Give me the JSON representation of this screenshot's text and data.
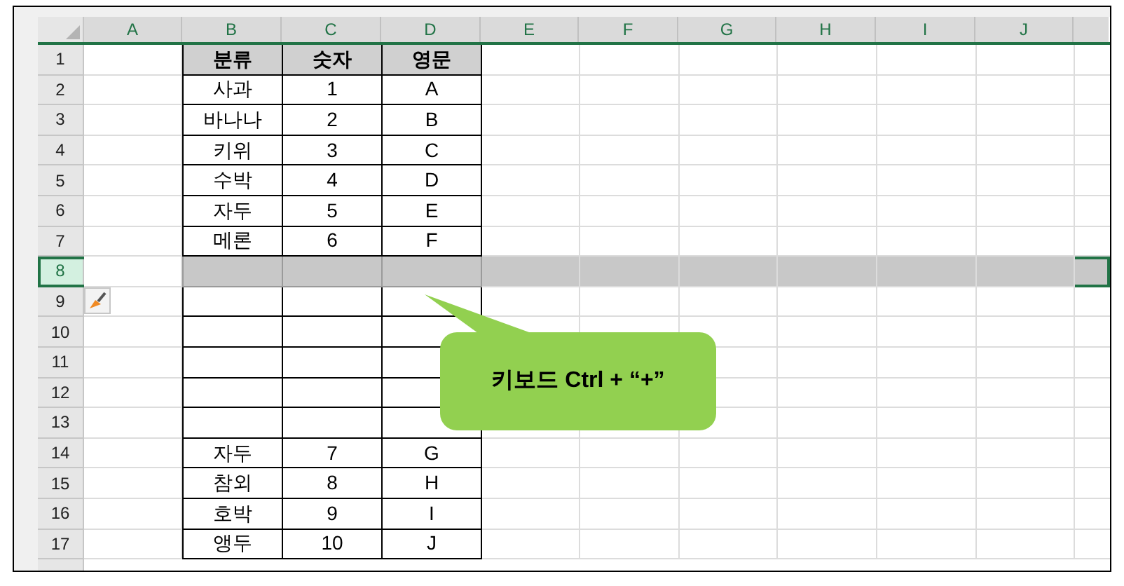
{
  "column_headers": [
    "A",
    "B",
    "C",
    "D",
    "E",
    "F",
    "G",
    "H",
    "I",
    "J"
  ],
  "rows": [
    {
      "number": "1",
      "kind": "header",
      "selected": false,
      "cells": [
        "분류",
        "숫자",
        "영문"
      ]
    },
    {
      "number": "2",
      "kind": "data",
      "selected": false,
      "cells": [
        "사과",
        "1",
        "A"
      ]
    },
    {
      "number": "3",
      "kind": "data",
      "selected": false,
      "cells": [
        "바나나",
        "2",
        "B"
      ]
    },
    {
      "number": "4",
      "kind": "data",
      "selected": false,
      "cells": [
        "키위",
        "3",
        "C"
      ]
    },
    {
      "number": "5",
      "kind": "data",
      "selected": false,
      "cells": [
        "수박",
        "4",
        "D"
      ]
    },
    {
      "number": "6",
      "kind": "data",
      "selected": false,
      "cells": [
        "자두",
        "5",
        "E"
      ]
    },
    {
      "number": "7",
      "kind": "data",
      "selected": false,
      "cells": [
        "메론",
        "6",
        "F"
      ]
    },
    {
      "number": "8",
      "kind": "data",
      "selected": true
    },
    {
      "number": "9",
      "kind": "data",
      "selected": false,
      "paste_options": true
    },
    {
      "number": "10",
      "kind": "data",
      "selected": false
    },
    {
      "number": "11",
      "kind": "data",
      "selected": false
    },
    {
      "number": "12",
      "kind": "data",
      "selected": false
    },
    {
      "number": "13",
      "kind": "data",
      "selected": false
    },
    {
      "number": "14",
      "kind": "data",
      "selected": false,
      "cells": [
        "자두",
        "7",
        "G"
      ]
    },
    {
      "number": "15",
      "kind": "data",
      "selected": false,
      "cells": [
        "참외",
        "8",
        "H"
      ]
    },
    {
      "number": "16",
      "kind": "data",
      "selected": false,
      "cells": [
        "호박",
        "9",
        "I"
      ]
    },
    {
      "number": "17",
      "kind": "data",
      "selected": false,
      "cells": [
        "앵두",
        "10",
        "J"
      ]
    }
  ],
  "callout": {
    "text": "키보드 Ctrl + “+”"
  }
}
